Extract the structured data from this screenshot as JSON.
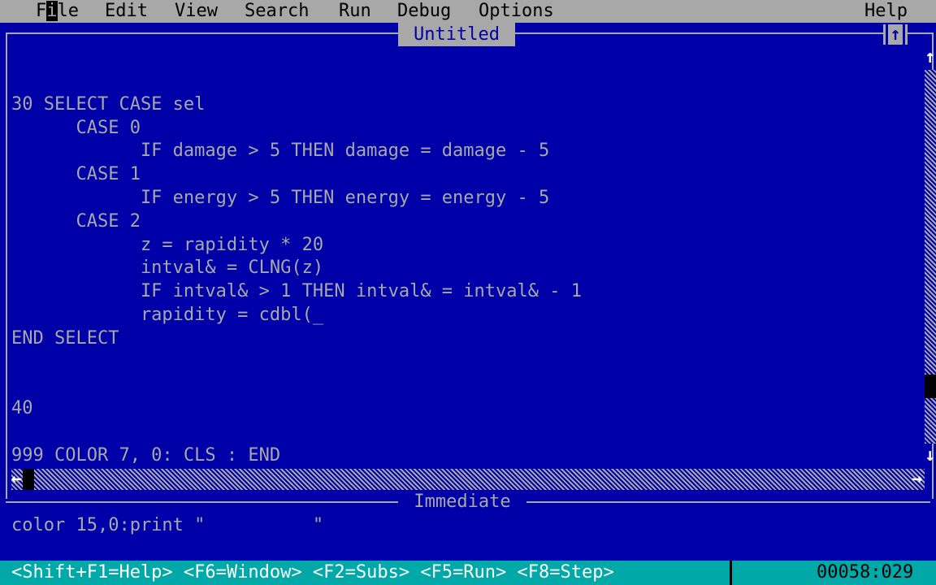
{
  "menu": {
    "items": [
      {
        "label_pre": "F",
        "hot": "i",
        "label_post": "le"
      },
      {
        "label": "Edit"
      },
      {
        "label": "View"
      },
      {
        "label": "Search"
      },
      {
        "label": "Run"
      },
      {
        "label": "Debug"
      },
      {
        "label": "Options"
      }
    ],
    "help": "Help"
  },
  "window": {
    "title": "Untitled",
    "maximize_glyph": "↑"
  },
  "code_lines": [
    "",
    "30 SELECT CASE sel",
    "      CASE 0",
    "            IF damage > 5 THEN damage = damage - 5",
    "      CASE 1",
    "            IF energy > 5 THEN energy = energy - 5",
    "      CASE 2",
    "            z = rapidity * 20",
    "            intval& = CLNG(z)",
    "            IF intval& > 1 THEN intval& = intval& - 1",
    "            rapidity = cdbl(_",
    "END SELECT",
    "",
    "",
    "40",
    "",
    "999 COLOR 7, 0: CLS : END"
  ],
  "scroll": {
    "up_arrow": "↑",
    "down_arrow": "↓",
    "left_arrow": "←",
    "right_arrow": "→"
  },
  "immediate": {
    "title": "Immediate",
    "text": "color 15,0:print \"          \""
  },
  "status": {
    "hints": "<Shift+F1=Help> <F6=Window> <F2=Subs> <F5=Run> <F8=Step>",
    "position": "00058:029"
  },
  "colors": {
    "background": "#0000a8",
    "foreground": "#a8a8a8",
    "statusbar": "#00a8a8"
  }
}
